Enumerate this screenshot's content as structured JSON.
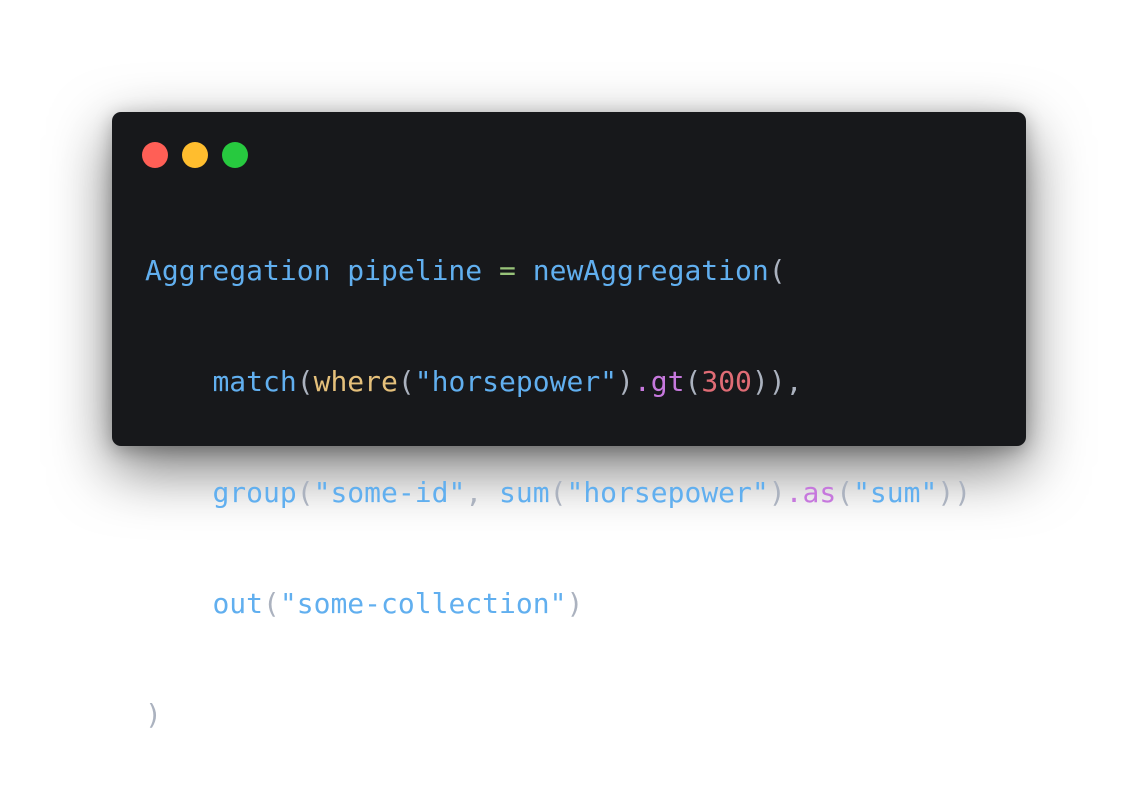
{
  "window": {
    "background": "#17181b",
    "traffic_lights": [
      {
        "name": "close",
        "color": "#ff5f56"
      },
      {
        "name": "minimize",
        "color": "#ffbd2e"
      },
      {
        "name": "zoom",
        "color": "#27c93f"
      }
    ]
  },
  "theme": {
    "plain": "#61afef",
    "punct": "#abb2bf",
    "operator": "#98c379",
    "func": "#61afef",
    "call": "#e5c07b",
    "string": "#61afef",
    "method": "#c678dd",
    "number": "#e06c75"
  },
  "code": {
    "lines": [
      [
        {
          "t": "Aggregation pipeline ",
          "k": "plain"
        },
        {
          "t": "=",
          "k": "operator"
        },
        {
          "t": " newAggregation",
          "k": "plain"
        },
        {
          "t": "(",
          "k": "punct"
        }
      ],
      [
        {
          "t": "    ",
          "k": "plain"
        },
        {
          "t": "match",
          "k": "func"
        },
        {
          "t": "(",
          "k": "punct"
        },
        {
          "t": "where",
          "k": "call"
        },
        {
          "t": "(",
          "k": "punct"
        },
        {
          "t": "\"horsepower\"",
          "k": "string"
        },
        {
          "t": ")",
          "k": "punct"
        },
        {
          "t": ".gt",
          "k": "method"
        },
        {
          "t": "(",
          "k": "punct"
        },
        {
          "t": "300",
          "k": "number"
        },
        {
          "t": ")),",
          "k": "punct"
        }
      ],
      [
        {
          "t": "    ",
          "k": "plain"
        },
        {
          "t": "group",
          "k": "func"
        },
        {
          "t": "(",
          "k": "punct"
        },
        {
          "t": "\"some-id\"",
          "k": "string"
        },
        {
          "t": ", ",
          "k": "punct"
        },
        {
          "t": "sum",
          "k": "func"
        },
        {
          "t": "(",
          "k": "punct"
        },
        {
          "t": "\"horsepower\"",
          "k": "string"
        },
        {
          "t": ")",
          "k": "punct"
        },
        {
          "t": ".as",
          "k": "method"
        },
        {
          "t": "(",
          "k": "punct"
        },
        {
          "t": "\"sum\"",
          "k": "string"
        },
        {
          "t": "))",
          "k": "punct"
        }
      ],
      [
        {
          "t": "    ",
          "k": "plain"
        },
        {
          "t": "out",
          "k": "func"
        },
        {
          "t": "(",
          "k": "punct"
        },
        {
          "t": "\"some-collection\"",
          "k": "string"
        },
        {
          "t": ")",
          "k": "punct"
        }
      ],
      [
        {
          "t": ")",
          "k": "punct"
        }
      ]
    ]
  }
}
